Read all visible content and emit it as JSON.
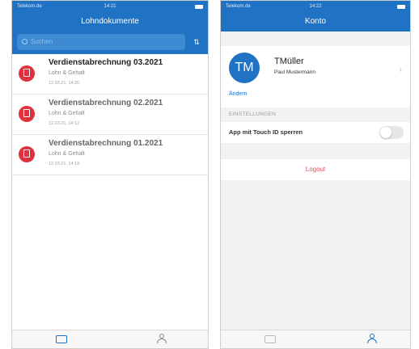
{
  "left_screen": {
    "status": {
      "carrier": "Telekom.de",
      "time": "14:21"
    },
    "title": "Lohndokumente",
    "search": {
      "placeholder": "Suchen"
    },
    "documents": [
      {
        "title": "Verdienstabrechnung 03.2021",
        "category": "Lohn & Gehalt",
        "date": "12.03.21, 14:20"
      },
      {
        "title": "Verdienstabrechnung 02.2021",
        "category": "Lohn & Gehalt",
        "date": "12.03.21, 14:12"
      },
      {
        "title": "Verdienstabrechnung 01.2021",
        "category": "Lohn & Gehalt",
        "date": "12.03.21, 14:13"
      }
    ],
    "active_tab": "documents"
  },
  "right_screen": {
    "status": {
      "carrier": "Telekom.de",
      "time": "14:22"
    },
    "title": "Konto",
    "profile": {
      "initials": "TM",
      "username": "TMüller",
      "full_name": "Paul Mustermann",
      "edit_label": "Ändern"
    },
    "settings_header": "EINSTELLUNGEN",
    "touch_id": {
      "label": "App mit Touch ID sperren",
      "enabled": false
    },
    "logout_label": "Logout",
    "active_tab": "account"
  },
  "colors": {
    "brand": "#1f72c4",
    "pdf": "#e0323e",
    "logout": "#e2505a"
  }
}
